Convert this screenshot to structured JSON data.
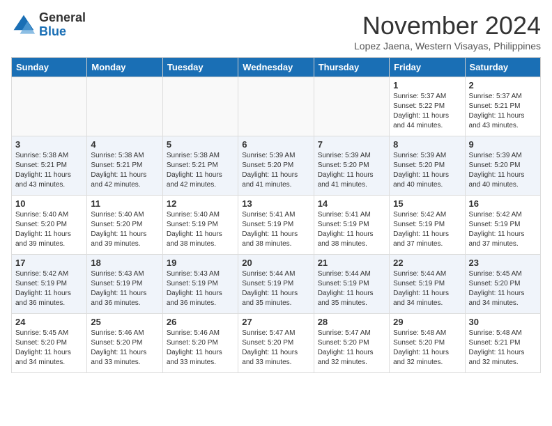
{
  "header": {
    "logo_general": "General",
    "logo_blue": "Blue",
    "month_title": "November 2024",
    "location": "Lopez Jaena, Western Visayas, Philippines"
  },
  "weekdays": [
    "Sunday",
    "Monday",
    "Tuesday",
    "Wednesday",
    "Thursday",
    "Friday",
    "Saturday"
  ],
  "weeks": [
    [
      {
        "day": "",
        "info": ""
      },
      {
        "day": "",
        "info": ""
      },
      {
        "day": "",
        "info": ""
      },
      {
        "day": "",
        "info": ""
      },
      {
        "day": "",
        "info": ""
      },
      {
        "day": "1",
        "info": "Sunrise: 5:37 AM\nSunset: 5:22 PM\nDaylight: 11 hours\nand 44 minutes."
      },
      {
        "day": "2",
        "info": "Sunrise: 5:37 AM\nSunset: 5:21 PM\nDaylight: 11 hours\nand 43 minutes."
      }
    ],
    [
      {
        "day": "3",
        "info": "Sunrise: 5:38 AM\nSunset: 5:21 PM\nDaylight: 11 hours\nand 43 minutes."
      },
      {
        "day": "4",
        "info": "Sunrise: 5:38 AM\nSunset: 5:21 PM\nDaylight: 11 hours\nand 42 minutes."
      },
      {
        "day": "5",
        "info": "Sunrise: 5:38 AM\nSunset: 5:21 PM\nDaylight: 11 hours\nand 42 minutes."
      },
      {
        "day": "6",
        "info": "Sunrise: 5:39 AM\nSunset: 5:20 PM\nDaylight: 11 hours\nand 41 minutes."
      },
      {
        "day": "7",
        "info": "Sunrise: 5:39 AM\nSunset: 5:20 PM\nDaylight: 11 hours\nand 41 minutes."
      },
      {
        "day": "8",
        "info": "Sunrise: 5:39 AM\nSunset: 5:20 PM\nDaylight: 11 hours\nand 40 minutes."
      },
      {
        "day": "9",
        "info": "Sunrise: 5:39 AM\nSunset: 5:20 PM\nDaylight: 11 hours\nand 40 minutes."
      }
    ],
    [
      {
        "day": "10",
        "info": "Sunrise: 5:40 AM\nSunset: 5:20 PM\nDaylight: 11 hours\nand 39 minutes."
      },
      {
        "day": "11",
        "info": "Sunrise: 5:40 AM\nSunset: 5:20 PM\nDaylight: 11 hours\nand 39 minutes."
      },
      {
        "day": "12",
        "info": "Sunrise: 5:40 AM\nSunset: 5:19 PM\nDaylight: 11 hours\nand 38 minutes."
      },
      {
        "day": "13",
        "info": "Sunrise: 5:41 AM\nSunset: 5:19 PM\nDaylight: 11 hours\nand 38 minutes."
      },
      {
        "day": "14",
        "info": "Sunrise: 5:41 AM\nSunset: 5:19 PM\nDaylight: 11 hours\nand 38 minutes."
      },
      {
        "day": "15",
        "info": "Sunrise: 5:42 AM\nSunset: 5:19 PM\nDaylight: 11 hours\nand 37 minutes."
      },
      {
        "day": "16",
        "info": "Sunrise: 5:42 AM\nSunset: 5:19 PM\nDaylight: 11 hours\nand 37 minutes."
      }
    ],
    [
      {
        "day": "17",
        "info": "Sunrise: 5:42 AM\nSunset: 5:19 PM\nDaylight: 11 hours\nand 36 minutes."
      },
      {
        "day": "18",
        "info": "Sunrise: 5:43 AM\nSunset: 5:19 PM\nDaylight: 11 hours\nand 36 minutes."
      },
      {
        "day": "19",
        "info": "Sunrise: 5:43 AM\nSunset: 5:19 PM\nDaylight: 11 hours\nand 36 minutes."
      },
      {
        "day": "20",
        "info": "Sunrise: 5:44 AM\nSunset: 5:19 PM\nDaylight: 11 hours\nand 35 minutes."
      },
      {
        "day": "21",
        "info": "Sunrise: 5:44 AM\nSunset: 5:19 PM\nDaylight: 11 hours\nand 35 minutes."
      },
      {
        "day": "22",
        "info": "Sunrise: 5:44 AM\nSunset: 5:19 PM\nDaylight: 11 hours\nand 34 minutes."
      },
      {
        "day": "23",
        "info": "Sunrise: 5:45 AM\nSunset: 5:20 PM\nDaylight: 11 hours\nand 34 minutes."
      }
    ],
    [
      {
        "day": "24",
        "info": "Sunrise: 5:45 AM\nSunset: 5:20 PM\nDaylight: 11 hours\nand 34 minutes."
      },
      {
        "day": "25",
        "info": "Sunrise: 5:46 AM\nSunset: 5:20 PM\nDaylight: 11 hours\nand 33 minutes."
      },
      {
        "day": "26",
        "info": "Sunrise: 5:46 AM\nSunset: 5:20 PM\nDaylight: 11 hours\nand 33 minutes."
      },
      {
        "day": "27",
        "info": "Sunrise: 5:47 AM\nSunset: 5:20 PM\nDaylight: 11 hours\nand 33 minutes."
      },
      {
        "day": "28",
        "info": "Sunrise: 5:47 AM\nSunset: 5:20 PM\nDaylight: 11 hours\nand 32 minutes."
      },
      {
        "day": "29",
        "info": "Sunrise: 5:48 AM\nSunset: 5:20 PM\nDaylight: 11 hours\nand 32 minutes."
      },
      {
        "day": "30",
        "info": "Sunrise: 5:48 AM\nSunset: 5:21 PM\nDaylight: 11 hours\nand 32 minutes."
      }
    ]
  ]
}
